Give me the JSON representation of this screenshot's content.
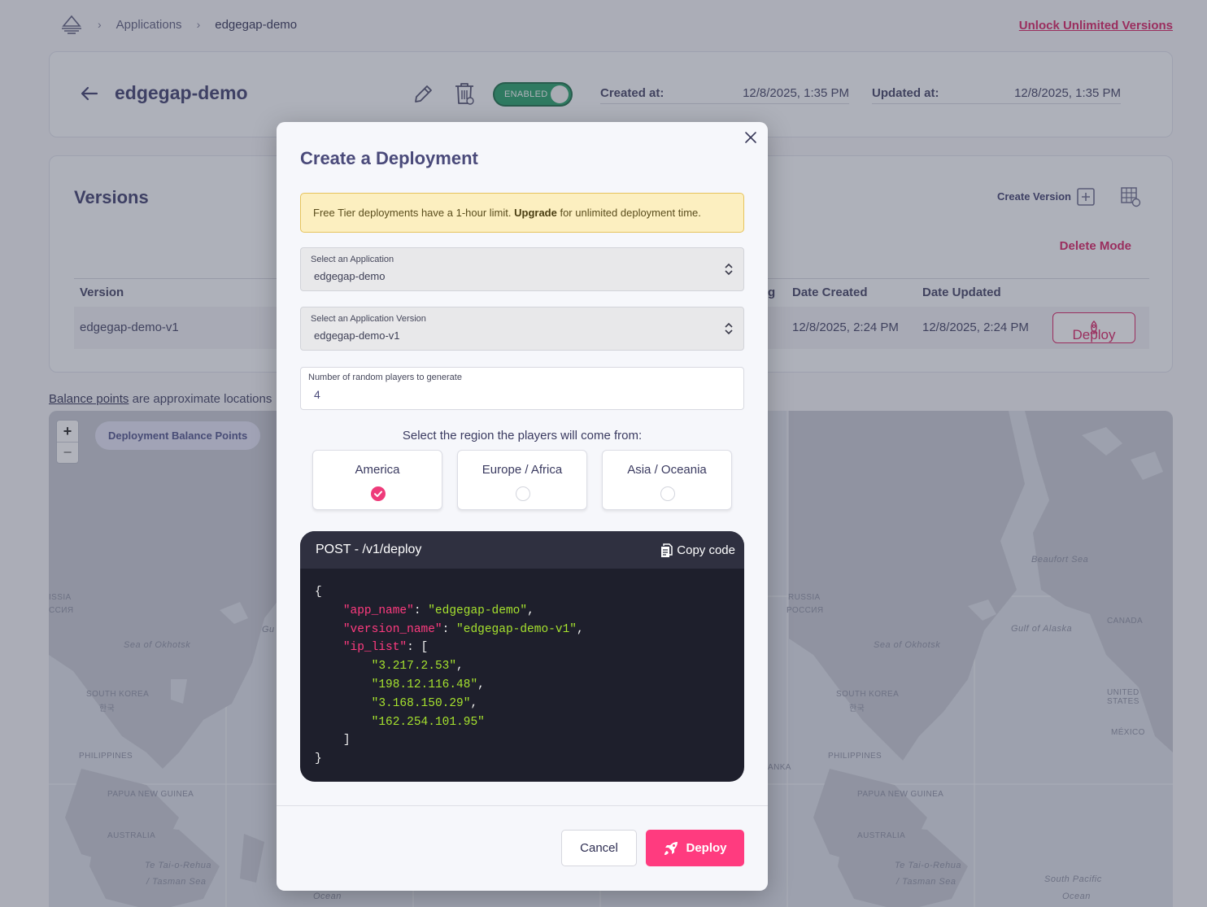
{
  "breadcrumb": {
    "items": [
      "Applications",
      "edgegap-demo"
    ]
  },
  "header_link": "Unlock Unlimited Versions",
  "app": {
    "name": "edgegap-demo",
    "status": "ENABLED",
    "created_label": "Created at:",
    "created_value": "12/8/2025, 1:35 PM",
    "updated_label": "Updated at:",
    "updated_value": "12/8/2025, 1:35 PM"
  },
  "versions": {
    "title": "Versions",
    "create_label": "Create Version",
    "delete_mode": "Delete Mode",
    "columns": {
      "version": "Version",
      "partial": "g",
      "date_created": "Date Created",
      "date_updated": "Date Updated"
    },
    "rows": [
      {
        "version": "edgegap-demo-v1",
        "date_created": "12/8/2025, 2:24 PM",
        "date_updated": "12/8/2025, 2:24 PM",
        "action": "Deploy"
      }
    ]
  },
  "balance": {
    "link": "Balance points",
    "rest": " are approximate locations"
  },
  "map": {
    "pill": "Deployment Balance Points",
    "zoom_in": "+",
    "zoom_out": "−",
    "labels": {
      "l_issia": "ISSIA",
      "l_ssiya": "ССИЯ",
      "l_okhotsk1": "Sea of Okhotsk",
      "l_gu": "Gu",
      "l_skorea1": "SOUTH KOREA",
      "l_skorea1b": "한국",
      "l_phil1": "PHILIPPINES",
      "l_png1": "PAPUA NEW GUINEA",
      "l_aus1": "AUSTRALIA",
      "l_tasman1a": "Te Tai-o-Rehua",
      "l_tasman1b": "/ Tasman Sea",
      "l_ocean1": "Ocean",
      "l_russia": "RUSSIA",
      "l_rossiya": "РОССИЯ",
      "l_okhotsk2": "Sea of Okhotsk",
      "l_beaufort": "Beaufort Sea",
      "l_alaska": "Gulf of Alaska",
      "l_canada": "CANADA",
      "l_us": "UNITED STATES",
      "l_mexico": "MÉXICO",
      "l_skorea2": "SOUTH KOREA",
      "l_skorea2b": "한국",
      "l_phil2": "PHILIPPINES",
      "l_anka": "ANKA",
      "l_png2": "PAPUA NEW GUINEA",
      "l_aus2": "AUSTRALIA",
      "l_tasman2a": "Te Tai-o-Rehua",
      "l_tasman2b": "/ Tasman Sea",
      "l_spacific1": "South Pacific",
      "l_spacific2": "Ocean"
    }
  },
  "modal": {
    "title": "Create a Deployment",
    "notice_pre": "Free Tier deployments have a 1-hour limit. ",
    "notice_bold": "Upgrade",
    "notice_post": " for unlimited deployment time.",
    "app_select": {
      "label": "Select an Application",
      "value": "edgegap-demo"
    },
    "version_select": {
      "label": "Select an Application Version",
      "value": "edgegap-demo-v1"
    },
    "players": {
      "label": "Number of random players to generate",
      "value": "4"
    },
    "region_heading": "Select the region the players will come from:",
    "regions": [
      {
        "name": "America",
        "selected": true
      },
      {
        "name": "Europe / Africa",
        "selected": false
      },
      {
        "name": "Asia / Oceania",
        "selected": false
      }
    ],
    "code": {
      "endpoint": "POST - /v1/deploy",
      "copy_label": "Copy code",
      "open_brace": "{",
      "k_app": "\"app_name\"",
      "v_app": "\"edgegap-demo\"",
      "k_ver": "\"version_name\"",
      "v_ver": "\"edgegap-demo-v1\"",
      "k_ip": "\"ip_list\"",
      "ip1": "\"3.217.2.53\"",
      "ip2": "\"198.12.116.48\"",
      "ip3": "\"3.168.150.29\"",
      "ip4": "\"162.254.101.95\"",
      "close_bracket": "]",
      "close_brace": "}"
    },
    "cancel_label": "Cancel",
    "deploy_label": "Deploy"
  },
  "colors": {
    "accent": "#ff3b7f",
    "brand_text": "#d81b60",
    "enabled": "#1f9d64",
    "code_bg": "#1e1f2c"
  }
}
